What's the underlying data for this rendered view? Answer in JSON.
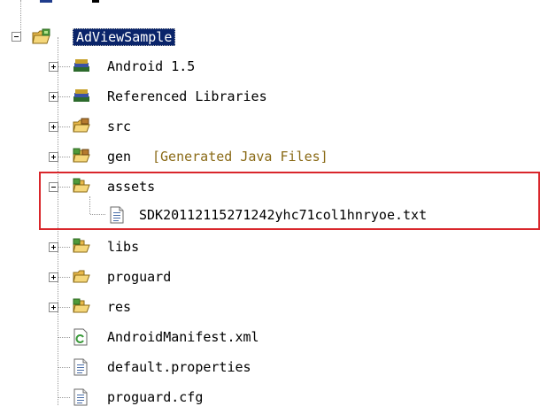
{
  "project": {
    "name": "AdViewSample",
    "children": [
      {
        "label": "Android 1.5",
        "icon": "library-books-icon",
        "expandable": true
      },
      {
        "label": "Referenced Libraries",
        "icon": "library-books-icon",
        "expandable": true
      },
      {
        "label": "src",
        "icon": "package-folder-icon",
        "expandable": true
      },
      {
        "label": "gen",
        "suffix": "[Generated Java Files]",
        "icon": "source-folder-icon",
        "expandable": true
      },
      {
        "label": "assets",
        "icon": "folder-open-icon",
        "expandable": true,
        "expanded": true
      },
      {
        "label": "SDK20112115271242yhc71col1hnryoe.txt",
        "icon": "text-file-icon",
        "expandable": false
      },
      {
        "label": "libs",
        "icon": "folder-icon",
        "expandable": true
      },
      {
        "label": "proguard",
        "icon": "folder-icon",
        "expandable": true
      },
      {
        "label": "res",
        "icon": "folder-icon",
        "expandable": true
      },
      {
        "label": "AndroidManifest.xml",
        "icon": "android-manifest-icon",
        "expandable": false
      },
      {
        "label": "default.properties",
        "icon": "properties-file-icon",
        "expandable": false
      },
      {
        "label": "proguard.cfg",
        "icon": "text-file-icon",
        "expandable": false
      }
    ]
  },
  "colors": {
    "selection_bg": "#0a246a",
    "highlight_border": "#d9262b",
    "generated_text": "#8a6a16",
    "folder": "#e8b84a"
  }
}
